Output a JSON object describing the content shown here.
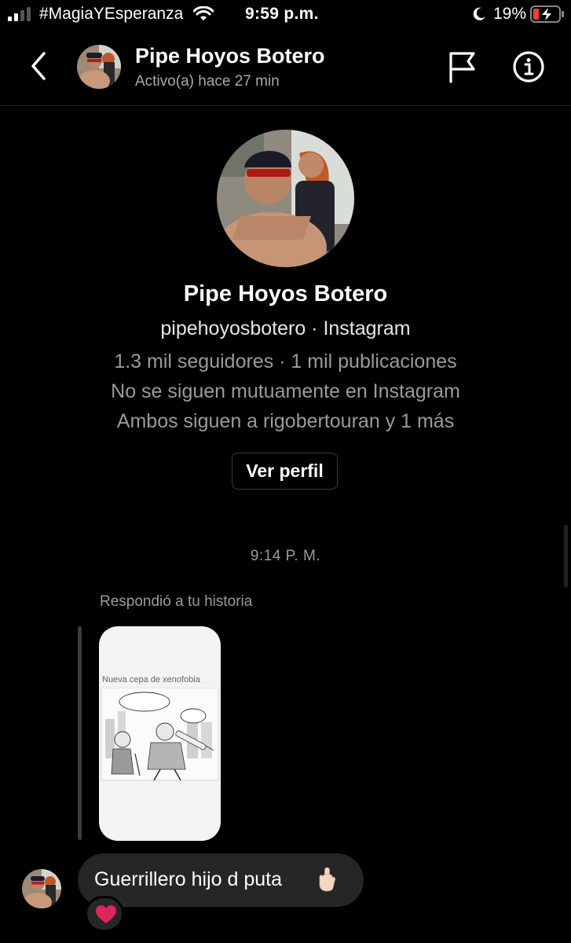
{
  "status_bar": {
    "carrier": "#MagiaYEsperanza",
    "time": "9:59 p.m.",
    "battery": "19%"
  },
  "header": {
    "name": "Pipe Hoyos Botero",
    "status": "Activo(a) hace 27 min"
  },
  "profile": {
    "name": "Pipe Hoyos Botero",
    "handle": "pipehoyosbotero · Instagram",
    "stats": "1.3 mil seguidores · 1 mil publicaciones",
    "follow_status": "No se siguen mutuamente en Instagram",
    "mutual": "Ambos siguen a rigobertouran y 1 más",
    "view_profile_label": "Ver perfil"
  },
  "conversation": {
    "timestamp": "9:14 P. M.",
    "story_reply_label": "Respondió a tu historia",
    "story_title": "Nueva cepa de xenofobia",
    "message_text": "Guerrillero hijo d puta",
    "message_emoji": "middle-finger-icon",
    "reaction": "heart-icon"
  },
  "colors": {
    "background": "#000000",
    "bubble": "#262626",
    "secondary_text": "#9a9a9a",
    "heart": "#e0245e",
    "battery_low": "#ff3b30"
  }
}
